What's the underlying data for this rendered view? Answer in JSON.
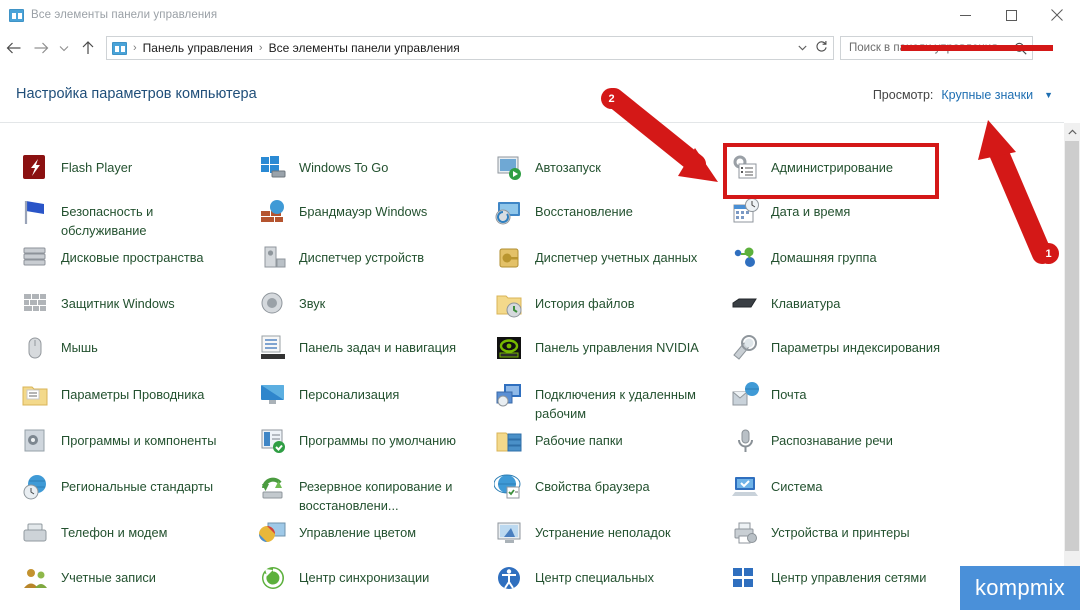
{
  "window": {
    "title": "Все элементы панели управления",
    "app_icon": "control-panel-icon",
    "minimize_label": "Свернуть",
    "maximize_label": "Развернуть",
    "close_label": "Закрыть"
  },
  "toolbar": {
    "back_icon": "back-arrow-icon",
    "forward_icon": "forward-arrow-icon",
    "recent_icon": "chevron-down-icon",
    "up_icon": "up-arrow-icon",
    "address_caret_icon": "chevron-down-icon",
    "refresh_icon": "refresh-icon",
    "breadcrumb": [
      "Панель управления",
      "Все элементы панели управления"
    ],
    "breadcrumb_separator": "›"
  },
  "search": {
    "placeholder": "Поиск в панели управления",
    "value": "",
    "icon": "search-icon"
  },
  "header": {
    "page_title": "Настройка параметров компьютера",
    "view_label": "Просмотр:",
    "view_value": "Крупные значки",
    "view_caret_icon": "chevron-down-icon"
  },
  "annotations": {
    "step1": "1",
    "step2": "2",
    "highlight_target": "Администрирование",
    "accent_color": "#d41817"
  },
  "watermark": {
    "text": "kompmix",
    "color": "#4a90d9"
  },
  "scrollbar": {
    "up_icon": "chevron-up-icon"
  },
  "columns": [
    {
      "items": [
        {
          "label": "Flash Player",
          "icon": "flash-player-icon"
        },
        {
          "label": "Безопасность и обслуживание",
          "icon": "flag-icon"
        },
        {
          "label": "Дисковые пространства",
          "icon": "storage-spaces-icon"
        },
        {
          "label": "Защитник Windows",
          "icon": "windows-defender-icon"
        },
        {
          "label": "Мышь",
          "icon": "mouse-icon"
        },
        {
          "label": "Параметры Проводника",
          "icon": "folder-options-icon"
        },
        {
          "label": "Программы и компоненты",
          "icon": "programs-features-icon"
        },
        {
          "label": "Региональные стандарты",
          "icon": "region-icon"
        },
        {
          "label": "Телефон и модем",
          "icon": "phone-modem-icon"
        },
        {
          "label": "Учетные записи",
          "icon": "user-accounts-icon"
        }
      ]
    },
    {
      "items": [
        {
          "label": "Windows To Go",
          "icon": "windows-to-go-icon"
        },
        {
          "label": "Брандмауэр Windows",
          "icon": "firewall-icon"
        },
        {
          "label": "Диспетчер устройств",
          "icon": "device-manager-icon"
        },
        {
          "label": "Звук",
          "icon": "sound-icon"
        },
        {
          "label": "Панель задач и навигация",
          "icon": "taskbar-icon"
        },
        {
          "label": "Персонализация",
          "icon": "personalization-icon"
        },
        {
          "label": "Программы по умолчанию",
          "icon": "default-programs-icon"
        },
        {
          "label": "Резервное копирование и восстановлени...",
          "icon": "backup-restore-icon"
        },
        {
          "label": "Управление цветом",
          "icon": "color-management-icon"
        },
        {
          "label": "Центр синхронизации",
          "icon": "sync-center-icon"
        }
      ]
    },
    {
      "items": [
        {
          "label": "Автозапуск",
          "icon": "autoplay-icon"
        },
        {
          "label": "Восстановление",
          "icon": "recovery-icon"
        },
        {
          "label": "Диспетчер учетных данных",
          "icon": "credential-manager-icon"
        },
        {
          "label": "История файлов",
          "icon": "file-history-icon"
        },
        {
          "label": "Панель управления NVIDIA",
          "icon": "nvidia-control-panel-icon"
        },
        {
          "label": "Подключения к удаленным рабочим",
          "icon": "remoteapp-icon"
        },
        {
          "label": "Рабочие папки",
          "icon": "work-folders-icon"
        },
        {
          "label": "Свойства браузера",
          "icon": "internet-options-icon"
        },
        {
          "label": "Устранение неполадок",
          "icon": "troubleshooting-icon"
        },
        {
          "label": "Центр специальных",
          "icon": "ease-of-access-icon"
        }
      ]
    },
    {
      "items": [
        {
          "label": "Администрирование",
          "icon": "administrative-tools-icon"
        },
        {
          "label": "Дата и время",
          "icon": "date-time-icon"
        },
        {
          "label": "Домашняя группа",
          "icon": "homegroup-icon"
        },
        {
          "label": "Клавиатура",
          "icon": "keyboard-icon"
        },
        {
          "label": "Параметры индексирования",
          "icon": "indexing-options-icon"
        },
        {
          "label": "Почта",
          "icon": "mail-icon"
        },
        {
          "label": "Распознавание речи",
          "icon": "speech-recognition-icon"
        },
        {
          "label": "Система",
          "icon": "system-icon"
        },
        {
          "label": "Устройства и принтеры",
          "icon": "devices-printers-icon"
        },
        {
          "label": "Центр управления сетями",
          "icon": "network-sharing-icon"
        }
      ]
    }
  ]
}
